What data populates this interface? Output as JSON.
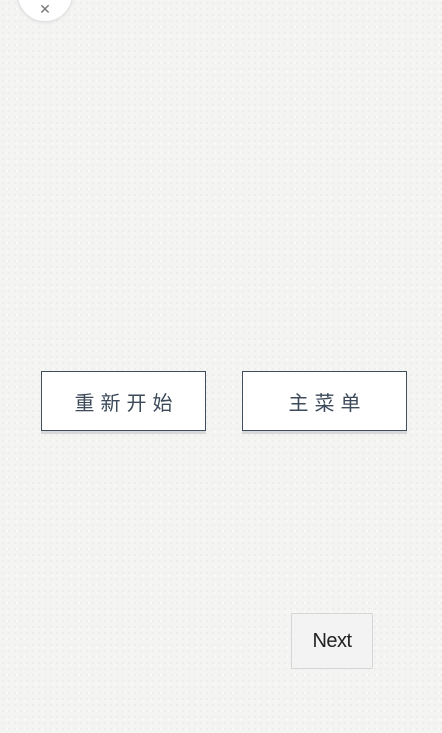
{
  "top_corner": {
    "icon": "close-icon",
    "glyph": "✕"
  },
  "menu": {
    "restart_label": "重新开始",
    "main_menu_label": "主菜单"
  },
  "navigation": {
    "next_label": "Next"
  },
  "colors": {
    "button_border": "#3f4d5c",
    "button_text": "#3c4a5a",
    "background": "#f4f4f3"
  }
}
